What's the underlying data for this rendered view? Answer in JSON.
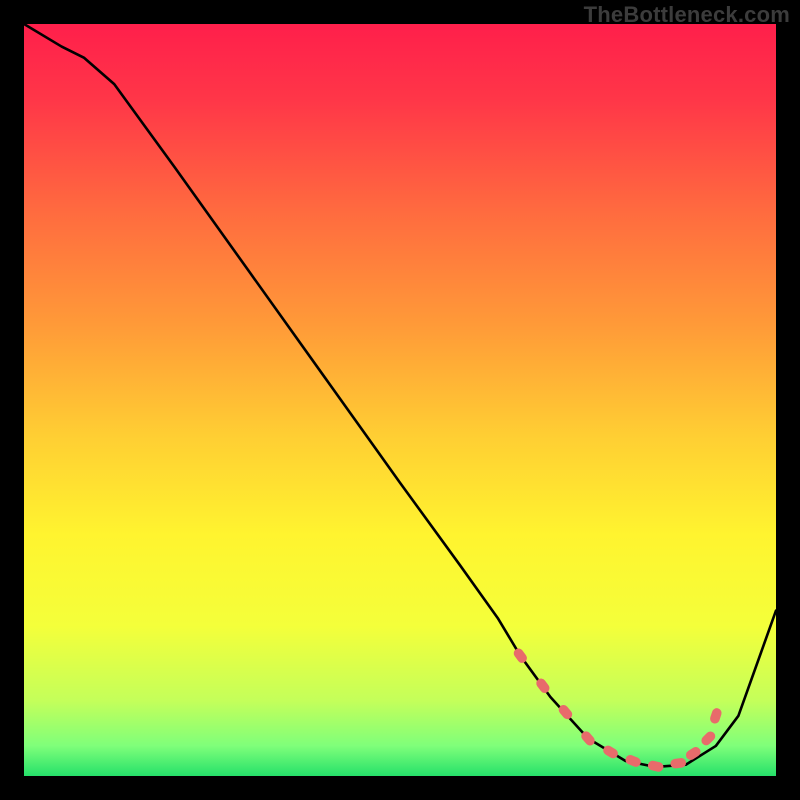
{
  "watermark": "TheBottleneck.com",
  "chart_data": {
    "type": "line",
    "title": "",
    "xlabel": "",
    "ylabel": "",
    "xlim": [
      0,
      100
    ],
    "ylim": [
      0,
      100
    ],
    "background_gradient_stops": [
      {
        "offset": 0.0,
        "color": "#ff1f4b"
      },
      {
        "offset": 0.1,
        "color": "#ff3648"
      },
      {
        "offset": 0.25,
        "color": "#ff6b3f"
      },
      {
        "offset": 0.4,
        "color": "#ff9a38"
      },
      {
        "offset": 0.55,
        "color": "#ffcf33"
      },
      {
        "offset": 0.68,
        "color": "#fff42f"
      },
      {
        "offset": 0.8,
        "color": "#f4ff3a"
      },
      {
        "offset": 0.9,
        "color": "#c4ff5a"
      },
      {
        "offset": 0.96,
        "color": "#7fff7a"
      },
      {
        "offset": 1.0,
        "color": "#25e06a"
      }
    ],
    "series": [
      {
        "name": "bottleneck-curve",
        "x": [
          0,
          5,
          8,
          12,
          20,
          30,
          40,
          50,
          58,
          63,
          66,
          70,
          75,
          80,
          84,
          88,
          92,
          95,
          100
        ],
        "y": [
          100,
          97,
          95.5,
          92,
          81,
          67,
          53,
          39,
          28,
          21,
          16,
          10.5,
          5,
          2,
          1.2,
          1.5,
          4,
          8,
          22
        ]
      }
    ],
    "markers": {
      "name": "highlight-dots",
      "color": "#e86b6b",
      "radius": 6,
      "x": [
        66,
        69,
        72,
        75,
        78,
        81,
        84,
        87,
        89,
        91,
        92
      ],
      "y": [
        16,
        12,
        8.5,
        5,
        3.2,
        2,
        1.3,
        1.7,
        3,
        5,
        8
      ]
    }
  }
}
